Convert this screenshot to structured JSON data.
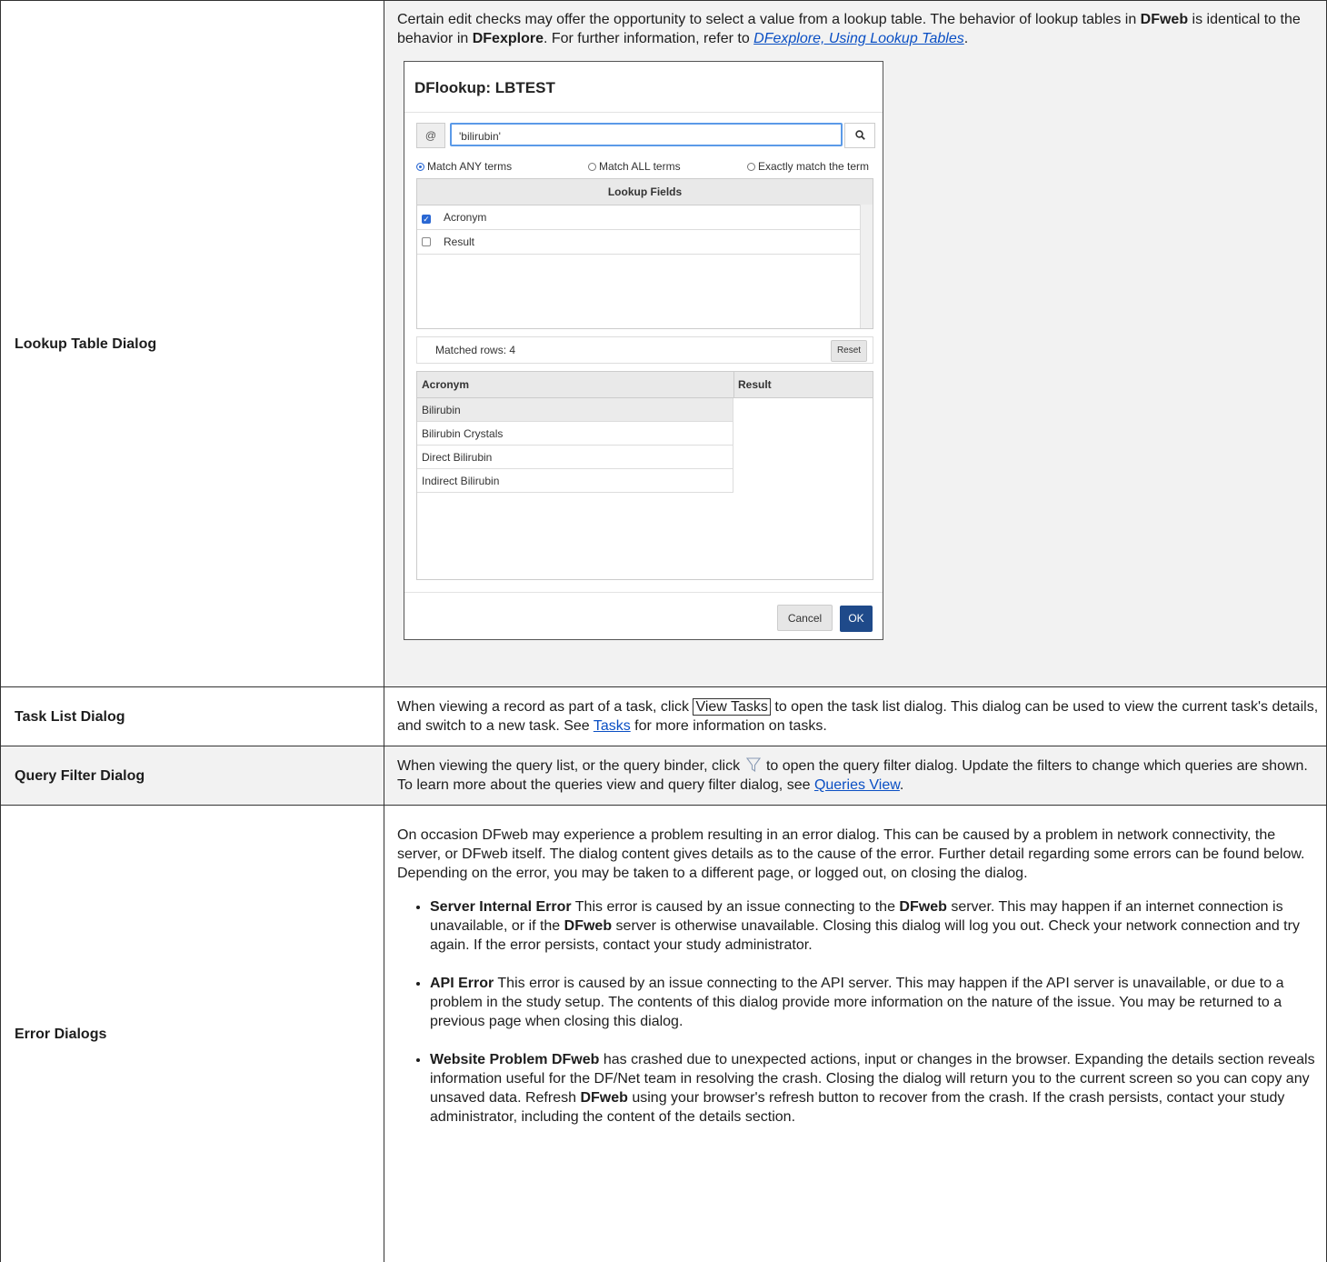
{
  "rows": {
    "lookup": {
      "label": "Lookup Table Dialog",
      "text_1": "Certain edit checks may offer the opportunity to select a value from a lookup table. The behavior of lookup tables in ",
      "bold_1": "DFweb",
      "text_2": " is identical to the behavior in ",
      "bold_2": "DFexplore",
      "text_3": ". For further information, refer to ",
      "link": "DFexplore, Using Lookup Tables",
      "text_4": "."
    },
    "task": {
      "label": "Task List Dialog",
      "text_1": "When viewing a record as part of a task, click ",
      "button": "View Tasks",
      "text_2": " to open the task list dialog. This dialog can be used to view the current task's details, and switch to a new task. See ",
      "link": "Tasks",
      "text_3": " for more information on tasks."
    },
    "query": {
      "label": "Query Filter Dialog",
      "text_1": "When viewing the query list, or the query binder, click ",
      "icon": "filter-icon",
      "text_2": " to open the query filter dialog. Update the filters to change which queries are shown. To learn more about the queries view and query filter dialog, see ",
      "link": "Queries View",
      "text_3": "."
    },
    "errors": {
      "label": "Error Dialogs",
      "intro": "On occasion DFweb may experience a problem resulting in an error dialog. This can be caused by a problem in network connectivity, the server, or DFweb itself. The dialog content gives details as to the cause of the error. Further detail regarding some errors can be found below. Depending on the error, you may be taken to a different page, or logged out, on closing the dialog.",
      "items": [
        {
          "title": "Server Internal Error",
          "t1": " This error is caused by an issue connecting to the ",
          "b1": "DFweb",
          "t2": " server. This may happen if an internet connection is unavailable, or if the ",
          "b2": "DFweb",
          "t3": " server is otherwise unavailable. Closing this dialog will log you out. Check your network connection and try again. If the error persists, contact your study administrator."
        },
        {
          "title": "API Error",
          "t1": " This error is caused by an issue connecting to the API server. This may happen if the API server is unavailable, or due to a problem in the study setup. The contents of this dialog provide more information on the nature of the issue. You may be returned to a previous page when closing this dialog."
        },
        {
          "title": "Website Problem",
          "b0": "DFweb",
          "t1": " has crashed due to unexpected actions, input or changes in the browser. Expanding the details section reveals information useful for the DF/Net team in resolving the crash. Closing the dialog will return you to the current screen so you can copy any unsaved data. Refresh ",
          "b1": "DFweb",
          "t2": " using your browser's refresh button to recover from the crash. If the crash persists, contact your study administrator, including the content of the details section."
        }
      ]
    }
  },
  "dialog": {
    "title": "DFlookup: LBTEST",
    "at_label": "@",
    "search_value": "'bilirubin'",
    "search_icon": "search-icon",
    "radios": [
      {
        "label": "Match ANY terms",
        "checked": true
      },
      {
        "label": "Match ALL terms",
        "checked": false
      },
      {
        "label": "Exactly match the term",
        "checked": false
      }
    ],
    "fields_header": "Lookup Fields",
    "fields": [
      {
        "label": "Acronym",
        "checked": true
      },
      {
        "label": "Result",
        "checked": false
      }
    ],
    "matched_label": "Matched rows: 4",
    "reset_label": "Reset",
    "columns": [
      "Acronym",
      "Result"
    ],
    "rows": [
      "Bilirubin",
      "Bilirubin Crystals",
      "Direct Bilirubin",
      "Indirect Bilirubin"
    ],
    "cancel_label": "Cancel",
    "ok_label": "OK",
    "colors": {
      "accent": "#2a68d3",
      "ok_button": "#1f4a8a",
      "link": "#0a4fc4"
    }
  }
}
